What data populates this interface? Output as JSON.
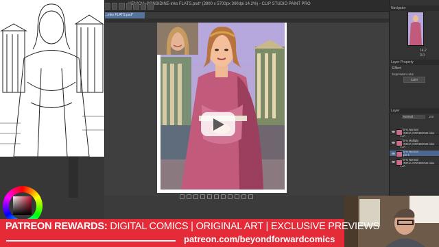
{
  "window": {
    "title": "VENICIA-CONSIDINE-inks FLATS.psd* (3900 x 5700px 300dpi 14.2%)  - CLIP STUDIO PAINT PRO",
    "file_tab": "...inks FLATS.psd*"
  },
  "right_panel": {
    "navigator_label": "Navigator",
    "zoom_value": "14.2",
    "rotation_value": "0.0",
    "layer_property_label": "Layer Property",
    "effect_label": "Effect",
    "expression_color_label": "Expression color",
    "expression_color_value": "Color",
    "layer_panel_label": "Layer",
    "blend_mode": "Normal",
    "opacity": "100",
    "layers": [
      {
        "line1": "100 % Normal",
        "line2": "VENICIA-CONSIDINE-inks FLA",
        "selected": false
      },
      {
        "line1": "100 % Multiply",
        "line2": "VENICIA-CONSIDINE-inks FLA",
        "selected": false
      },
      {
        "line1": "100 % Normal",
        "line2": "Layer 1",
        "selected": true
      },
      {
        "line1": "100 % Normal",
        "line2": "VENICIA-CONSIDINE-inks FLA",
        "selected": false
      }
    ]
  },
  "banner": {
    "heading_bold": "PATREON REWARDS:",
    "heading_rest": " DIGITAL COMICS | ORIGINAL ART | EXCLUSIVE PREVIEWS",
    "url": "patreon.com/beyondforwardcomics"
  },
  "colors": {
    "banner_red": "#e52b38",
    "selected_layer": "#4d6890",
    "file_tab": "#56739c",
    "dress": "#c25a7c"
  }
}
